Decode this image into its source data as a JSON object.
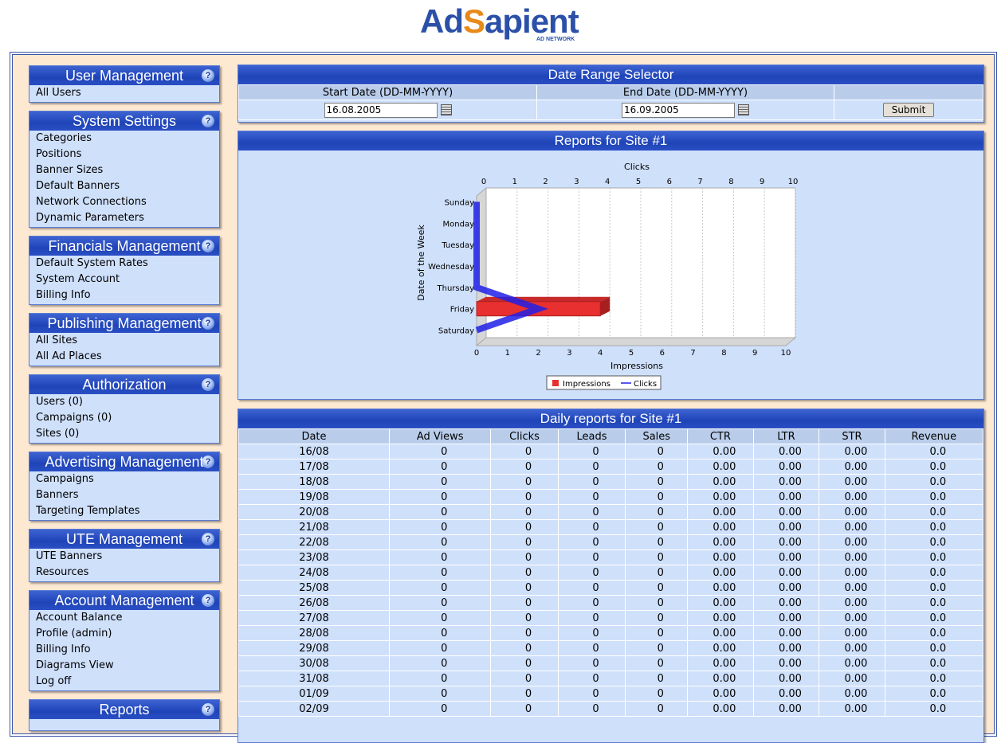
{
  "logo": {
    "ad": "Ad",
    "s": "S",
    "apient": "apient",
    "tagline": "AD NETWORK"
  },
  "sidebar": [
    {
      "title": "User Management",
      "items": [
        "All Users"
      ]
    },
    {
      "title": "System Settings",
      "items": [
        "Categories",
        "Positions",
        "Banner Sizes",
        "Default Banners",
        "Network Connections",
        "Dynamic Parameters"
      ]
    },
    {
      "title": "Financials Management",
      "items": [
        "Default System Rates",
        "System Account",
        "Billing Info"
      ]
    },
    {
      "title": "Publishing Management",
      "items": [
        "All Sites",
        "All Ad Places"
      ]
    },
    {
      "title": "Authorization",
      "items": [
        "Users (0)",
        "Campaigns (0)",
        "Sites (0)"
      ]
    },
    {
      "title": "Advertising Management",
      "items": [
        "Campaigns",
        "Banners",
        "Targeting Templates"
      ]
    },
    {
      "title": "UTE Management",
      "items": [
        "UTE Banners",
        "Resources"
      ]
    },
    {
      "title": "Account Management",
      "items": [
        "Account Balance",
        "Profile (admin)",
        "Billing Info",
        "Diagrams View",
        "Log off"
      ]
    },
    {
      "title": "Reports",
      "items": []
    }
  ],
  "help_glyph": "?",
  "date_range": {
    "title": "Date Range Selector",
    "start_label": "Start Date (DD-MM-YYYY)",
    "end_label": "End Date (DD-MM-YYYY)",
    "start_value": "16.08.2005",
    "end_value": "16.09.2005",
    "submit_label": "Submit"
  },
  "report": {
    "title": "Reports for Site #1"
  },
  "chart_data": {
    "type": "bar",
    "orientation": "horizontal",
    "categories": [
      "Sunday",
      "Monday",
      "Tuesday",
      "Wednesday",
      "Thursday",
      "Friday",
      "Saturday"
    ],
    "series": [
      {
        "name": "Impressions",
        "type": "bar",
        "color": "#e83030",
        "values": [
          0,
          0,
          0,
          0,
          0,
          4,
          0
        ]
      },
      {
        "name": "Clicks",
        "type": "line",
        "color": "#2020e8",
        "values": [
          0,
          0,
          0,
          0,
          0,
          2,
          0
        ]
      }
    ],
    "xlabel": "Impressions",
    "x2label": "Clicks",
    "ylabel": "Date of the Week",
    "xlim": [
      0,
      10
    ],
    "x2lim": [
      0,
      10
    ],
    "xticks": [
      "0",
      "1",
      "2",
      "3",
      "4",
      "5",
      "6",
      "7",
      "8",
      "9",
      "10"
    ],
    "grid": true,
    "legend": "bottom"
  },
  "daily": {
    "title": "Daily reports for Site #1",
    "columns": [
      "Date",
      "Ad Views",
      "Clicks",
      "Leads",
      "Sales",
      "CTR",
      "LTR",
      "STR",
      "Revenue"
    ],
    "rows": [
      [
        "16/08",
        "0",
        "0",
        "0",
        "0",
        "0.00",
        "0.00",
        "0.00",
        "0.0"
      ],
      [
        "17/08",
        "0",
        "0",
        "0",
        "0",
        "0.00",
        "0.00",
        "0.00",
        "0.0"
      ],
      [
        "18/08",
        "0",
        "0",
        "0",
        "0",
        "0.00",
        "0.00",
        "0.00",
        "0.0"
      ],
      [
        "19/08",
        "0",
        "0",
        "0",
        "0",
        "0.00",
        "0.00",
        "0.00",
        "0.0"
      ],
      [
        "20/08",
        "0",
        "0",
        "0",
        "0",
        "0.00",
        "0.00",
        "0.00",
        "0.0"
      ],
      [
        "21/08",
        "0",
        "0",
        "0",
        "0",
        "0.00",
        "0.00",
        "0.00",
        "0.0"
      ],
      [
        "22/08",
        "0",
        "0",
        "0",
        "0",
        "0.00",
        "0.00",
        "0.00",
        "0.0"
      ],
      [
        "23/08",
        "0",
        "0",
        "0",
        "0",
        "0.00",
        "0.00",
        "0.00",
        "0.0"
      ],
      [
        "24/08",
        "0",
        "0",
        "0",
        "0",
        "0.00",
        "0.00",
        "0.00",
        "0.0"
      ],
      [
        "25/08",
        "0",
        "0",
        "0",
        "0",
        "0.00",
        "0.00",
        "0.00",
        "0.0"
      ],
      [
        "26/08",
        "0",
        "0",
        "0",
        "0",
        "0.00",
        "0.00",
        "0.00",
        "0.0"
      ],
      [
        "27/08",
        "0",
        "0",
        "0",
        "0",
        "0.00",
        "0.00",
        "0.00",
        "0.0"
      ],
      [
        "28/08",
        "0",
        "0",
        "0",
        "0",
        "0.00",
        "0.00",
        "0.00",
        "0.0"
      ],
      [
        "29/08",
        "0",
        "0",
        "0",
        "0",
        "0.00",
        "0.00",
        "0.00",
        "0.0"
      ],
      [
        "30/08",
        "0",
        "0",
        "0",
        "0",
        "0.00",
        "0.00",
        "0.00",
        "0.0"
      ],
      [
        "31/08",
        "0",
        "0",
        "0",
        "0",
        "0.00",
        "0.00",
        "0.00",
        "0.0"
      ],
      [
        "01/09",
        "0",
        "0",
        "0",
        "0",
        "0.00",
        "0.00",
        "0.00",
        "0.0"
      ],
      [
        "02/09",
        "0",
        "0",
        "0",
        "0",
        "0.00",
        "0.00",
        "0.00",
        "0.0"
      ]
    ]
  }
}
